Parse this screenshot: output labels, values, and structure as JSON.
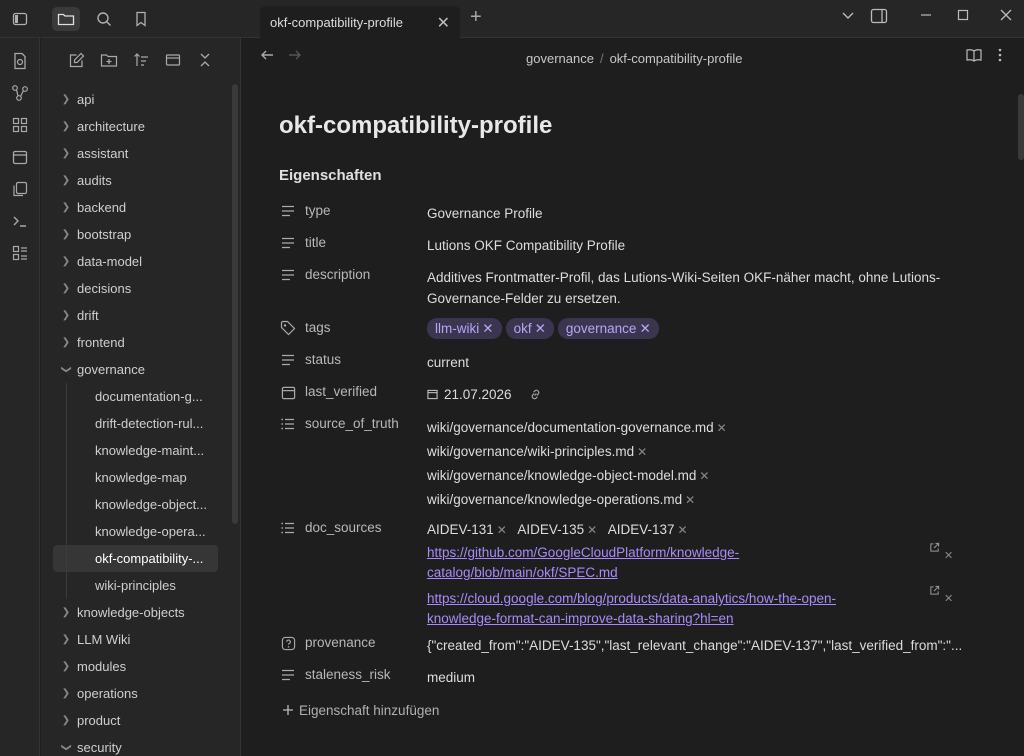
{
  "window": {
    "tab_title": "okf-compatibility-profile",
    "tab_close": "✕",
    "tab_new": "+"
  },
  "breadcrumb": {
    "folder": "governance",
    "separator": "/",
    "file": "okf-compatibility-profile"
  },
  "sidebar": {
    "items": [
      {
        "label": "api",
        "type": "folder"
      },
      {
        "label": "architecture",
        "type": "folder"
      },
      {
        "label": "assistant",
        "type": "folder"
      },
      {
        "label": "audits",
        "type": "folder"
      },
      {
        "label": "backend",
        "type": "folder"
      },
      {
        "label": "bootstrap",
        "type": "folder"
      },
      {
        "label": "data-model",
        "type": "folder"
      },
      {
        "label": "decisions",
        "type": "folder"
      },
      {
        "label": "drift",
        "type": "folder"
      },
      {
        "label": "frontend",
        "type": "folder"
      },
      {
        "label": "governance",
        "type": "folder-open"
      },
      {
        "label": "documentation-g...",
        "type": "file"
      },
      {
        "label": "drift-detection-rul...",
        "type": "file"
      },
      {
        "label": "knowledge-maint...",
        "type": "file"
      },
      {
        "label": "knowledge-map",
        "type": "file"
      },
      {
        "label": "knowledge-object...",
        "type": "file"
      },
      {
        "label": "knowledge-opera...",
        "type": "file"
      },
      {
        "label": "okf-compatibility-...",
        "type": "file-selected"
      },
      {
        "label": "wiki-principles",
        "type": "file"
      },
      {
        "label": "knowledge-objects",
        "type": "folder"
      },
      {
        "label": "LLM Wiki",
        "type": "folder"
      },
      {
        "label": "modules",
        "type": "folder"
      },
      {
        "label": "operations",
        "type": "folder"
      },
      {
        "label": "product",
        "type": "folder"
      },
      {
        "label": "security",
        "type": "folder-open"
      }
    ]
  },
  "note": {
    "title": "okf-compatibility-profile",
    "properties_heading": "Eigenschaften",
    "add_property": "Eigenschaft hinzufügen",
    "properties": {
      "type": {
        "name": "type",
        "value": "Governance Profile"
      },
      "title": {
        "name": "title",
        "value": "Lutions OKF Compatibility Profile"
      },
      "description": {
        "name": "description",
        "value": "Additives Frontmatter-Profil, das Lutions-Wiki-Seiten OKF-näher macht, ohne Lutions-Governance-Felder zu ersetzen."
      },
      "tags": {
        "name": "tags",
        "values": [
          "llm-wiki",
          "okf",
          "governance"
        ]
      },
      "status": {
        "name": "status",
        "value": "current"
      },
      "last_verified": {
        "name": "last_verified",
        "value": "21.07.2026"
      },
      "source_of_truth": {
        "name": "source_of_truth",
        "values": [
          "wiki/governance/documentation-governance.md",
          "wiki/governance/wiki-principles.md",
          "wiki/governance/knowledge-object-model.md",
          "wiki/governance/knowledge-operations.md"
        ]
      },
      "doc_sources": {
        "name": "doc_sources",
        "ids": [
          "AIDEV-131",
          "AIDEV-135",
          "AIDEV-137"
        ],
        "link1_line1": "https://github.com/GoogleCloudPlatform/knowledge-",
        "link1_line2": "catalog/blob/main/okf/SPEC.md",
        "link2_line1": "https://cloud.google.com/blog/products/data-analytics/how-the-open-",
        "link2_line2": "knowledge-format-can-improve-data-sharing?hl=en"
      },
      "provenance": {
        "name": "provenance",
        "value": "{\"created_from\":\"AIDEV-135\",\"last_relevant_change\":\"AIDEV-137\",\"last_verified_from\":\"..."
      },
      "staleness_risk": {
        "name": "staleness_risk",
        "value": "medium"
      }
    }
  },
  "colors": {
    "accent": "#a88bfa",
    "tag_bg": "#3b3550",
    "provenance": "#e4913a"
  }
}
